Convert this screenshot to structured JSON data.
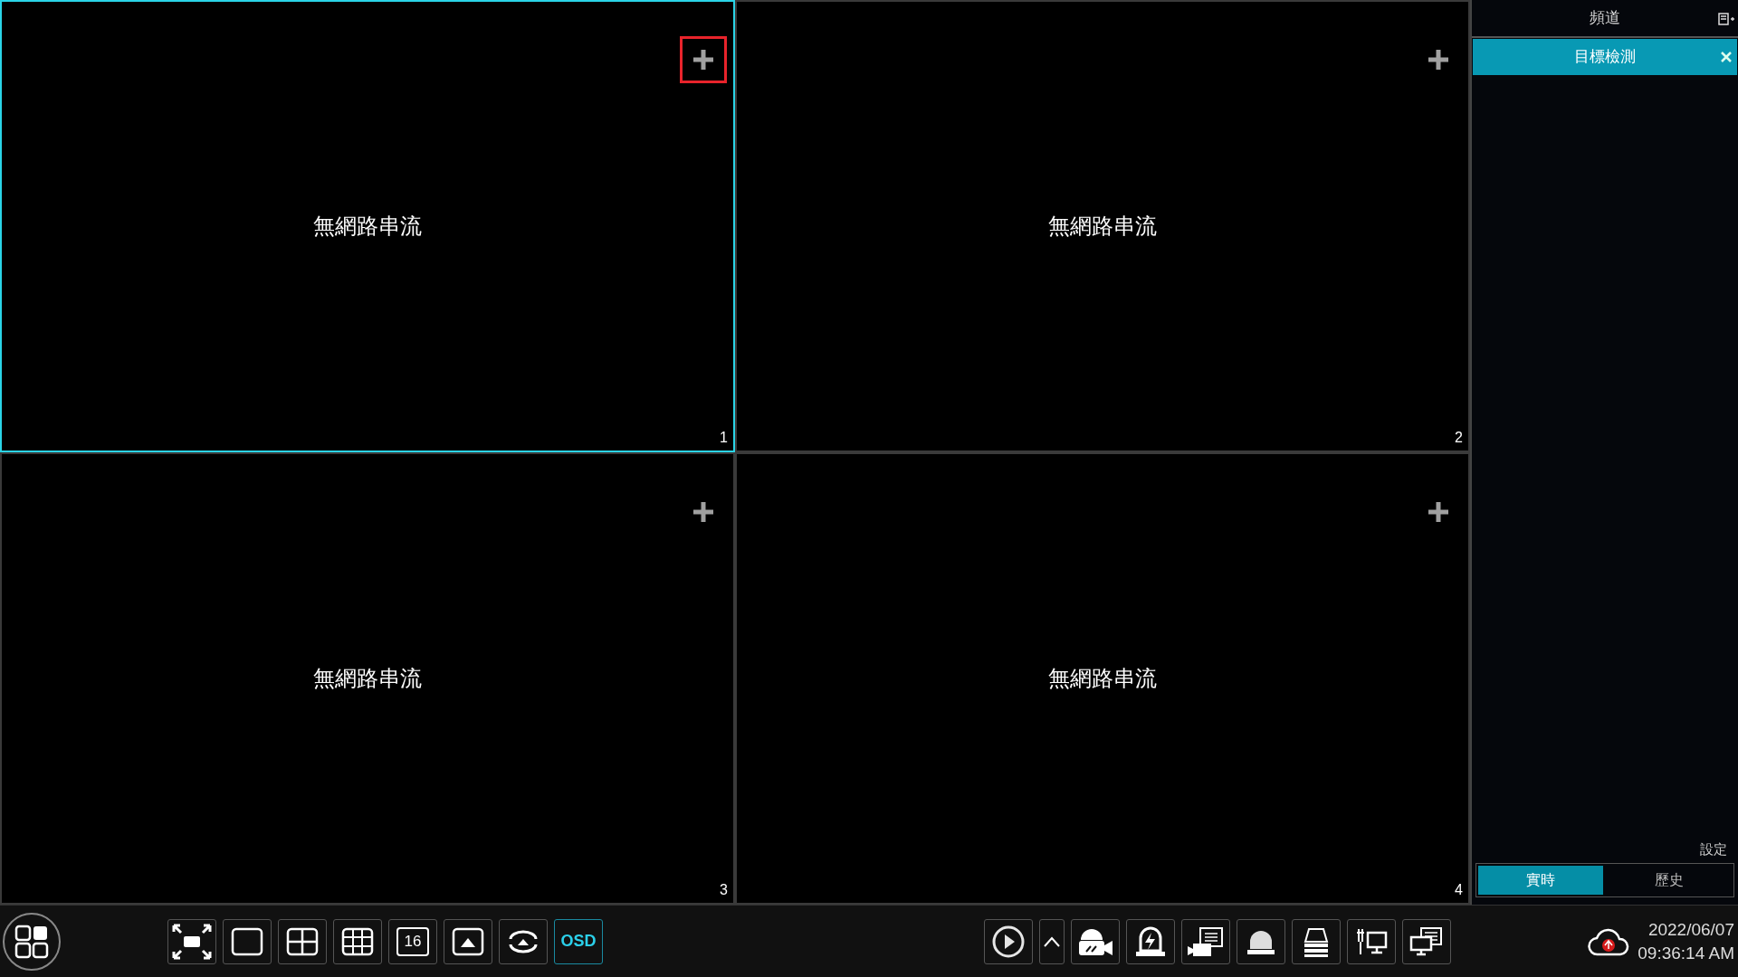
{
  "tiles": [
    {
      "message": "無網路串流",
      "number": "1",
      "selected": true,
      "add_highlighted": true
    },
    {
      "message": "無網路串流",
      "number": "2",
      "selected": false,
      "add_highlighted": false
    },
    {
      "message": "無網路串流",
      "number": "3",
      "selected": false,
      "add_highlighted": false
    },
    {
      "message": "無網路串流",
      "number": "4",
      "selected": false,
      "add_highlighted": false
    }
  ],
  "sidebar": {
    "title": "頻道",
    "panels": [
      {
        "label": "目標檢測",
        "selected": true
      }
    ],
    "settings_link": "設定",
    "tabs": [
      {
        "label": "實時",
        "selected": true
      },
      {
        "label": "歷史",
        "selected": false
      }
    ]
  },
  "toolbar": {
    "split16_label": "16",
    "osd": {
      "label": "OSD",
      "selected": true
    }
  },
  "status": {
    "date": "2022/06/07",
    "time": "09:36:14 AM"
  }
}
